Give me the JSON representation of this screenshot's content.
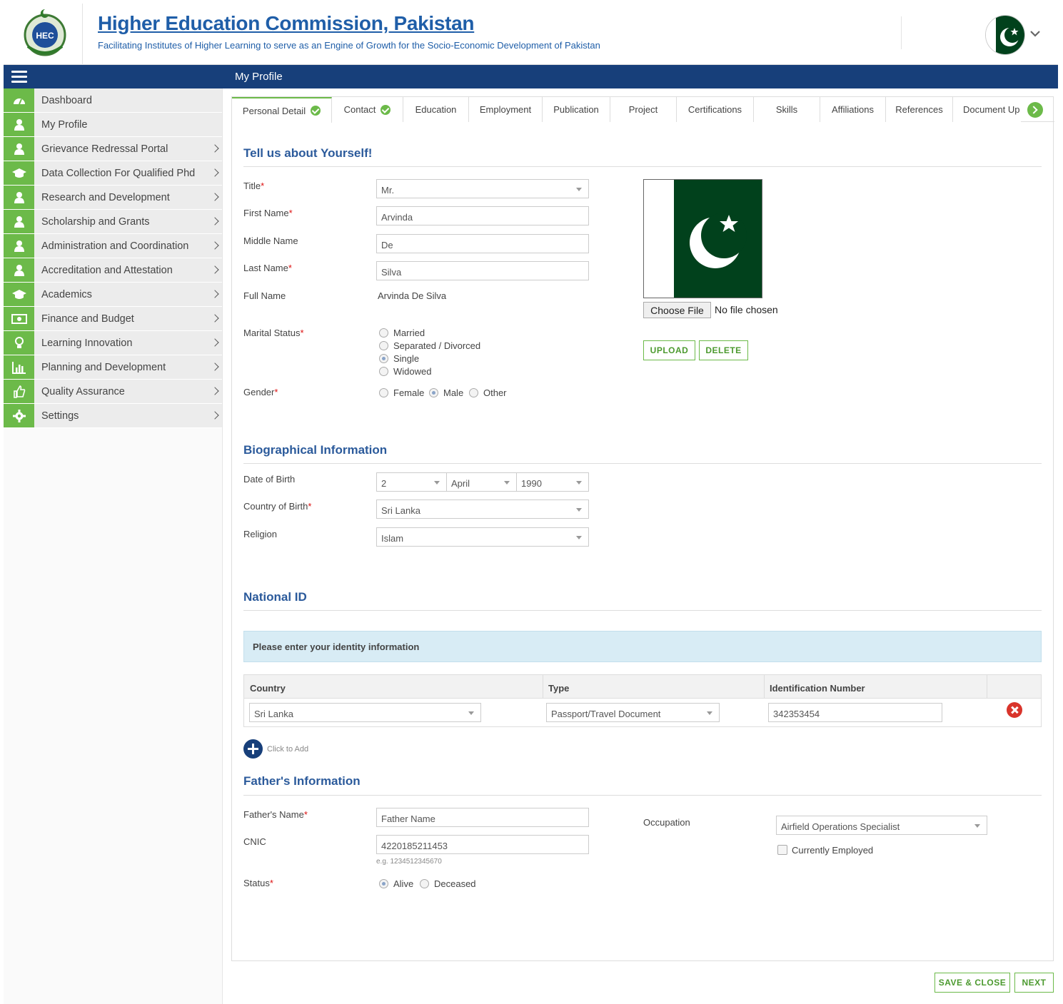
{
  "header": {
    "title": "Higher Education Commission, Pakistan",
    "subtitle": "Facilitating Institutes of Higher Learning to serve as an Engine of Growth for the Socio-Economic Development of Pakistan",
    "logo_text": "HEC"
  },
  "topbar": {
    "title": "My Profile"
  },
  "sidebar": {
    "items": [
      {
        "label": "Dashboard",
        "icon": "dashboard-icon",
        "arrow": false
      },
      {
        "label": "My Profile",
        "icon": "user-icon",
        "arrow": false
      },
      {
        "label": "Grievance Redressal Portal",
        "icon": "user-icon",
        "arrow": true
      },
      {
        "label": "Data Collection For Qualified Phd",
        "icon": "graduation-cap-icon",
        "arrow": true
      },
      {
        "label": "Research and Development",
        "icon": "user-icon",
        "arrow": true
      },
      {
        "label": "Scholarship and Grants",
        "icon": "user-icon",
        "arrow": true
      },
      {
        "label": "Administration and Coordination",
        "icon": "user-icon",
        "arrow": true
      },
      {
        "label": "Accreditation and Attestation",
        "icon": "user-icon",
        "arrow": true
      },
      {
        "label": "Academics",
        "icon": "graduation-cap-icon",
        "arrow": true
      },
      {
        "label": "Finance and Budget",
        "icon": "money-icon",
        "arrow": true
      },
      {
        "label": "Learning Innovation",
        "icon": "lightbulb-icon",
        "arrow": true
      },
      {
        "label": "Planning and Development",
        "icon": "bar-chart-icon",
        "arrow": true
      },
      {
        "label": "Quality Assurance",
        "icon": "thumbs-up-icon",
        "arrow": true
      },
      {
        "label": "Settings",
        "icon": "gear-icon",
        "arrow": true
      }
    ]
  },
  "tabs": [
    {
      "label": "Personal Detail",
      "check": true
    },
    {
      "label": "Contact",
      "check": true
    },
    {
      "label": "Education",
      "check": false
    },
    {
      "label": "Employment",
      "check": false
    },
    {
      "label": "Publication",
      "check": false
    },
    {
      "label": "Project",
      "check": false
    },
    {
      "label": "Certifications",
      "check": false
    },
    {
      "label": "Skills",
      "check": false
    },
    {
      "label": "Affiliations",
      "check": false
    },
    {
      "label": "References",
      "check": false
    },
    {
      "label": "Document Up",
      "check": false
    }
  ],
  "about": {
    "heading": "Tell us about Yourself!",
    "title_label": "Title",
    "title_value": "Mr.",
    "first_label": "First Name",
    "first_value": "Arvinda",
    "middle_label": "Middle Name",
    "middle_value": "De",
    "last_label": "Last Name",
    "last_value": "Silva",
    "full_label": "Full Name",
    "full_value": "Arvinda De Silva",
    "marital_label": "Marital Status",
    "marital_options": [
      "Married",
      "Separated / Divorced",
      "Single",
      "Widowed"
    ],
    "marital_selected": "Single",
    "gender_label": "Gender",
    "gender_options": [
      "Female",
      "Male",
      "Other"
    ],
    "gender_selected": "Male",
    "choose_file": "Choose File",
    "no_file": "No file chosen",
    "upload": "UPLOAD",
    "delete": "DELETE"
  },
  "bio": {
    "heading": "Biographical Information",
    "dob_label": "Date of Birth",
    "dob_day": "2",
    "dob_month": "April",
    "dob_year": "1990",
    "cob_label": "Country of Birth",
    "cob_value": "Sri Lanka",
    "religion_label": "Religion",
    "religion_value": "Islam"
  },
  "nid": {
    "heading": "National ID",
    "info": "Please enter your identity information",
    "col_country": "Country",
    "col_type": "Type",
    "col_id": "Identification Number",
    "row_country": "Sri Lanka",
    "row_type": "Passport/Travel Document",
    "row_id": "342353454",
    "add": "Click to Add"
  },
  "father": {
    "heading": "Father's Information",
    "name_label": "Father's Name",
    "name_value": "Father Name",
    "cnic_label": "CNIC",
    "cnic_value": "4220185211453",
    "cnic_hint": "e.g. 1234512345670",
    "status_label": "Status",
    "status_options": [
      "Alive",
      "Deceased"
    ],
    "status_selected": "Alive",
    "occupation_label": "Occupation",
    "occupation_value": "Airfield Operations Specialist",
    "employed_label": "Currently Employed"
  },
  "footer": {
    "save_close": "SAVE & CLOSE",
    "next": "NEXT"
  },
  "colors": {
    "navy": "#173f7a",
    "green": "#6cba49",
    "link_blue": "#1f5ea8",
    "flag_green": "#01411c"
  }
}
